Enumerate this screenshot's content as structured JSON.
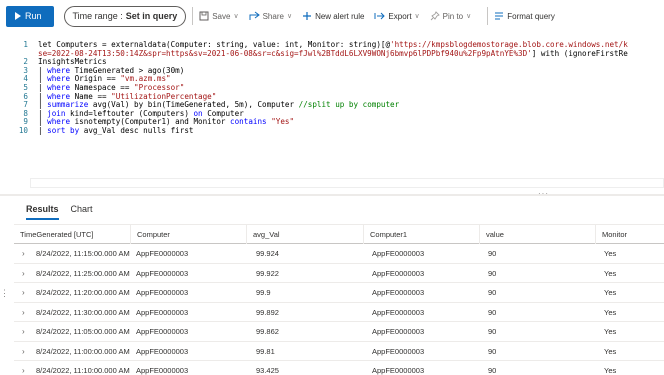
{
  "toolbar": {
    "run_label": "Run",
    "time_range_prefix": "Time range :",
    "time_range_value": "Set in query",
    "save_label": "Save",
    "share_label": "Share",
    "new_alert_label": "New alert rule",
    "export_label": "Export",
    "pin_label": "Pin to",
    "format_label": "Format query"
  },
  "editor": {
    "lines": [
      {
        "n": "1",
        "parts": [
          [
            "tx",
            "let Computers = externaldata(Computer: string, value: int, Monitor: string)[@"
          ],
          [
            "str",
            "'https://kmpsblogdemostorage.blob.core.windows.net/k"
          ]
        ]
      },
      {
        "n": "",
        "parts": [
          [
            "str",
            "se=2022-08-24T13:50:14Z&spr=https&sv=2021-06-08&sr=c&sig=fJwl%2BTddL6LXV9WONj6bmvp6lPDPbf940u%2Fp9pAtnYE%3D'"
          ],
          [
            "tx",
            "] with (ignoreFirstRe"
          ]
        ]
      },
      {
        "n": "2",
        "parts": [
          [
            "tx",
            "InsightsMetrics"
          ]
        ]
      },
      {
        "n": "3",
        "parts": [
          [
            "pipe",
            "| "
          ],
          [
            "kw",
            "where"
          ],
          [
            "tx",
            " TimeGenerated > ago(30m)"
          ]
        ]
      },
      {
        "n": "4",
        "parts": [
          [
            "pipe",
            "| "
          ],
          [
            "kw",
            "where"
          ],
          [
            "tx",
            " Origin == "
          ],
          [
            "str",
            "\"vm.azm.ms\""
          ]
        ]
      },
      {
        "n": "5",
        "parts": [
          [
            "pipe",
            "| "
          ],
          [
            "kw",
            "where"
          ],
          [
            "tx",
            " Namespace == "
          ],
          [
            "str",
            "\"Processor\""
          ]
        ]
      },
      {
        "n": "6",
        "parts": [
          [
            "pipe",
            "| "
          ],
          [
            "kw",
            "where"
          ],
          [
            "tx",
            " Name == "
          ],
          [
            "str",
            "\"UtilizationPercentage\""
          ]
        ]
      },
      {
        "n": "7",
        "parts": [
          [
            "pipe",
            "| "
          ],
          [
            "kw",
            "summarize"
          ],
          [
            "tx",
            " avg(Val) by bin(TimeGenerated, 5m), Computer "
          ],
          [
            "cmt",
            "//split up by computer"
          ]
        ]
      },
      {
        "n": "8",
        "parts": [
          [
            "pipe",
            "| "
          ],
          [
            "kw",
            "join"
          ],
          [
            "tx",
            " kind=leftouter (Computers) "
          ],
          [
            "kw",
            "on"
          ],
          [
            "tx",
            " Computer"
          ]
        ]
      },
      {
        "n": "9",
        "parts": [
          [
            "pipe",
            "| "
          ],
          [
            "kw",
            "where"
          ],
          [
            "tx",
            " isnotempty(Computer1) and Monitor "
          ],
          [
            "kw",
            "contains"
          ],
          [
            "tx",
            " "
          ],
          [
            "str",
            "\"Yes\""
          ]
        ]
      },
      {
        "n": "10",
        "parts": [
          [
            "pipe",
            "| "
          ],
          [
            "kw",
            "sort by"
          ],
          [
            "tx",
            " avg_Val desc nulls first"
          ]
        ]
      }
    ]
  },
  "results": {
    "tabs": [
      "Results",
      "Chart"
    ],
    "columns": [
      "TimeGenerated [UTC]",
      "Computer",
      "avg_Val",
      "Computer1",
      "value",
      "Monitor"
    ],
    "rows": [
      [
        "8/24/2022, 11:15:00.000 AM",
        "AppFE0000003",
        "99.924",
        "AppFE0000003",
        "90",
        "Yes"
      ],
      [
        "8/24/2022, 11:25:00.000 AM",
        "AppFE0000003",
        "99.922",
        "AppFE0000003",
        "90",
        "Yes"
      ],
      [
        "8/24/2022, 11:20:00.000 AM",
        "AppFE0000003",
        "99.9",
        "AppFE0000003",
        "90",
        "Yes"
      ],
      [
        "8/24/2022, 11:30:00.000 AM",
        "AppFE0000003",
        "99.892",
        "AppFE0000003",
        "90",
        "Yes"
      ],
      [
        "8/24/2022, 11:05:00.000 AM",
        "AppFE0000003",
        "99.862",
        "AppFE0000003",
        "90",
        "Yes"
      ],
      [
        "8/24/2022, 11:00:00.000 AM",
        "AppFE0000003",
        "99.81",
        "AppFE0000003",
        "90",
        "Yes"
      ],
      [
        "8/24/2022, 11:10:00.000 AM",
        "AppFE0000003",
        "93.425",
        "AppFE0000003",
        "90",
        "Yes"
      ]
    ]
  },
  "colors": {
    "accent": "#0f6cbd",
    "keyword": "#0000ff",
    "string": "#a31515",
    "comment": "#008000",
    "line_number": "#237893"
  },
  "icons": {
    "run": "play-icon",
    "save": "save-icon",
    "share": "share-icon",
    "new_alert": "plus-icon",
    "export": "export-icon",
    "pin": "pin-icon",
    "format": "format-icon",
    "expand": "chevron-right-icon"
  }
}
